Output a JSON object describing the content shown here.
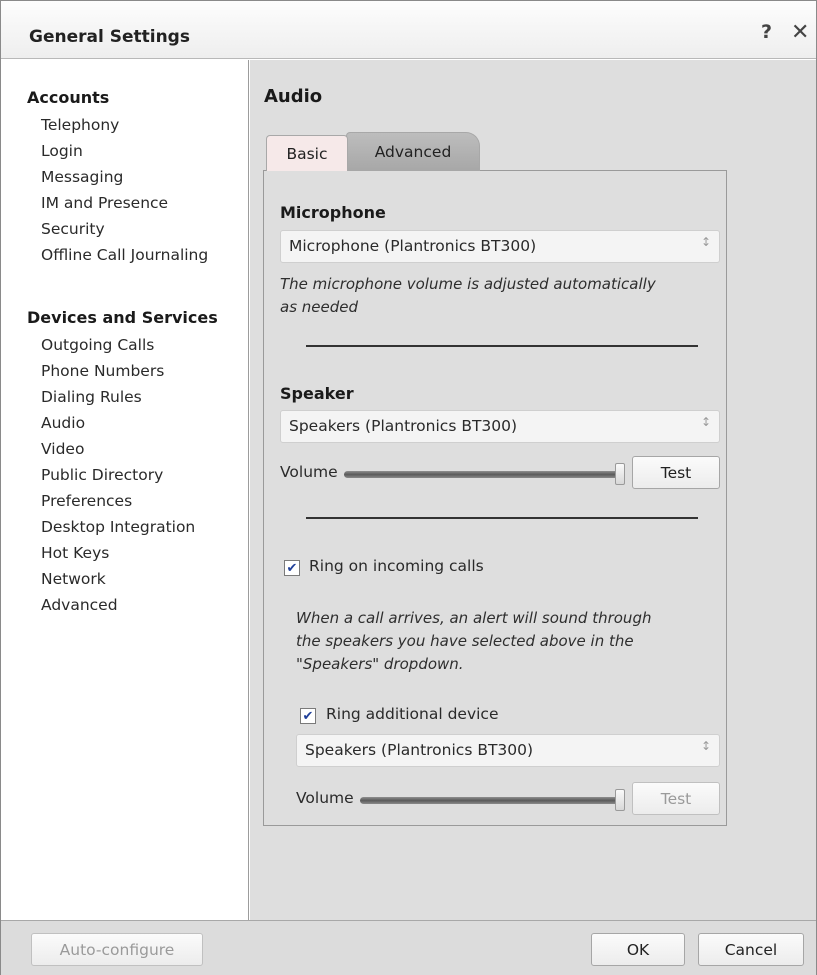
{
  "window": {
    "title": "General Settings",
    "help_glyph": "?",
    "close_glyph": "✕"
  },
  "sidebar": {
    "groups": [
      {
        "heading": "Accounts",
        "items": [
          "Telephony",
          "Login",
          "Messaging",
          "IM and Presence",
          "Security",
          "Offline Call Journaling"
        ]
      },
      {
        "heading": "Devices and Services",
        "items": [
          "Outgoing Calls",
          "Phone Numbers",
          "Dialing Rules",
          "Audio",
          "Video",
          "Public Directory",
          "Preferences",
          "Desktop Integration",
          "Hot Keys",
          "Network",
          "Advanced"
        ]
      }
    ]
  },
  "main": {
    "section_title": "Audio",
    "tabs": [
      {
        "label": "Basic",
        "selected": true
      },
      {
        "label": "Advanced",
        "selected": false
      }
    ],
    "microphone": {
      "heading": "Microphone",
      "selected": "Microphone (Plantronics BT300)",
      "note_line1": "The microphone volume is adjusted automatically",
      "note_line2": "as needed"
    },
    "speaker": {
      "heading": "Speaker",
      "selected": "Speakers (Plantronics BT300)",
      "volume_label": "Volume",
      "volume_level": 1.0,
      "test_label": "Test"
    },
    "ring": {
      "checkbox_label": "Ring on incoming calls",
      "checked": true,
      "note_line1": "When a call arrives, an alert will sound through",
      "note_line2": "the speakers you have selected above in the",
      "note_line3": "\"Speakers\" dropdown.",
      "additional": {
        "checkbox_label": "Ring additional device",
        "checked": true,
        "selected": "Speakers (Plantronics BT300)",
        "volume_label": "Volume",
        "volume_level": 1.0,
        "test_label": "Test"
      }
    },
    "check_glyph": "✔",
    "arrow_glyph": "↕"
  },
  "footer": {
    "autoconfigure_label": "Auto-configure",
    "ok_label": "OK",
    "cancel_label": "Cancel"
  },
  "colors": {
    "panel_bg": "#dedede",
    "basic_tab": "#f6e9e9",
    "advanced_tab": "#b0b0b0",
    "check": "#1f3f99"
  }
}
